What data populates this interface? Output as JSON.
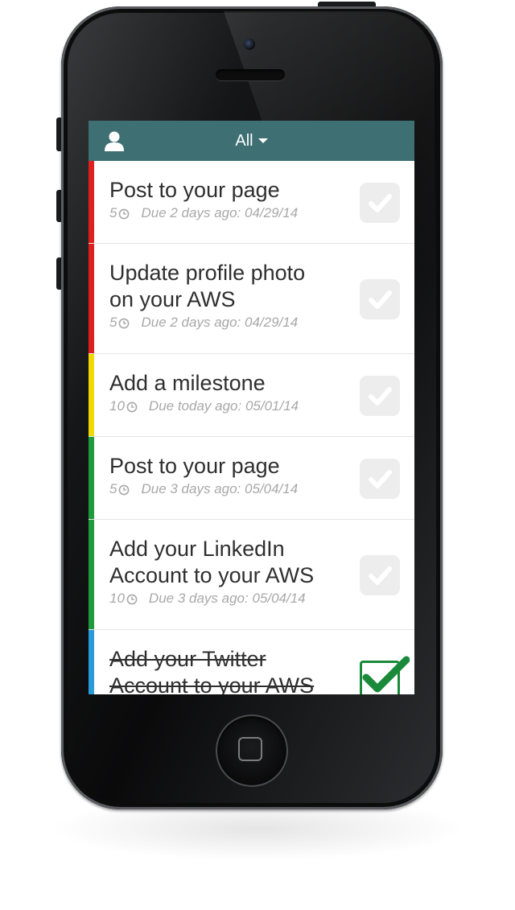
{
  "nav": {
    "filter_label": "All",
    "bar_color": "#3e6f73"
  },
  "tasks": [
    {
      "title_lines": [
        "Post to your page"
      ],
      "points": "5",
      "due": "Due 2 days ago: 04/29/14",
      "stripe_color": "#e02020",
      "completed": false
    },
    {
      "title_lines": [
        "Update profile photo",
        "on your AWS"
      ],
      "points": "5",
      "due": "Due 2 days ago: 04/29/14",
      "stripe_color": "#e02020",
      "completed": false
    },
    {
      "title_lines": [
        "Add a milestone"
      ],
      "points": "10",
      "due": "Due today ago: 05/01/14",
      "stripe_color": "#f0d800",
      "completed": false
    },
    {
      "title_lines": [
        "Post to your page"
      ],
      "points": "5",
      "due": "Due 3 days ago: 05/04/14",
      "stripe_color": "#1f9a3c",
      "completed": false
    },
    {
      "title_lines": [
        "Add your LinkedIn",
        "Account to your AWS"
      ],
      "points": "10",
      "due": "Due 3 days ago: 05/04/14",
      "stripe_color": "#1f9a3c",
      "completed": false
    },
    {
      "title_lines": [
        "Add your Twitter",
        "Account to your AWS"
      ],
      "points": "",
      "due": "",
      "stripe_color": "#2a9ad8",
      "completed": true
    }
  ],
  "icons": {
    "user": "user-icon",
    "filter_caret": "chevron-down-icon",
    "clock": "clock-icon",
    "check": "checkmark-icon"
  },
  "colors": {
    "check_done": "#1a8a3a",
    "check_idle": "#ededed"
  }
}
